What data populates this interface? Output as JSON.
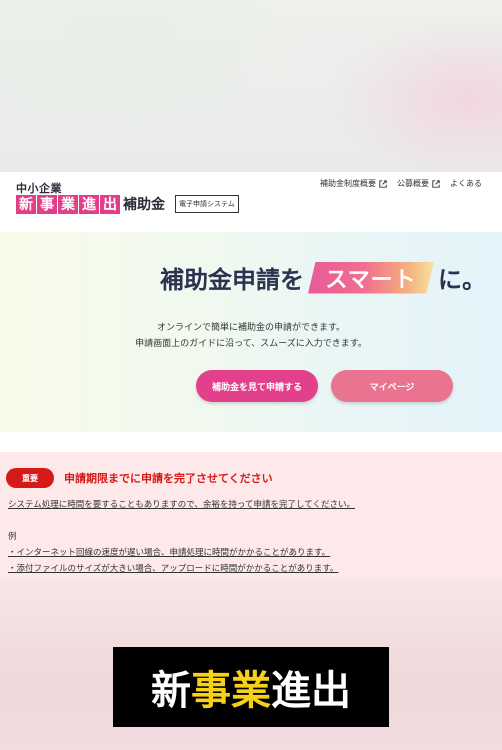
{
  "header": {
    "logo_top": "中小企業",
    "logo_tiles": [
      "新",
      "事",
      "業",
      "進",
      "出"
    ],
    "logo_suffix": "補助金",
    "logo_system": "電子申請システム",
    "nav": [
      {
        "label": "補助金制度概要"
      },
      {
        "label": "公募概要"
      },
      {
        "label": "よくある"
      }
    ]
  },
  "hero": {
    "title_pre": "補助金申請を",
    "title_highlight": "スマート",
    "title_post": "に。",
    "desc_line1": "オンラインで簡単に補助金の申請ができます。",
    "desc_line2": "申請画面上のガイドに沿って、スムーズに入力できます。",
    "apply_button": "補助金を見て申請する",
    "mypage_button": "マイページ"
  },
  "notice": {
    "badge": "重要",
    "heading": "申請期限までに申請を完了させてください",
    "line1": "システム処理に時間を要することもありますので、余裕を持って申請を完了してください。",
    "example_label": "例",
    "line2": "・インターネット回線の速度が遅い場合、申請処理に時間がかかることがあります。",
    "line3": "・添付ファイルのサイズが大きい場合、アップロードに時間がかかることがあります。"
  },
  "overlay_logo": {
    "part1": "新",
    "part2": "事業",
    "part3": "進出"
  },
  "colors": {
    "brand_pink": "#e0408a",
    "navy": "#2b3350",
    "alert_red": "#d61a1a",
    "logo_yellow": "#f7d117"
  }
}
